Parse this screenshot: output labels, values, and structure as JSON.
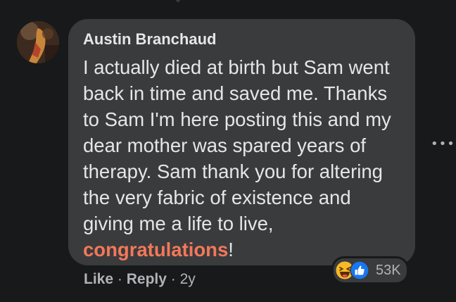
{
  "comment": {
    "author": "Austin Branchaud",
    "lines": [
      "I actually died at birth but Sam went",
      "back in time and saved me. Thanks",
      "to Sam I'm here posting this and my",
      "dear mother was spared years of",
      "therapy. Sam thank you for altering",
      "the very fabric of existence and",
      "giving me a life to live,"
    ],
    "highlight_word": "congratulations",
    "ending_punctuation": "!",
    "highlight_color": "#f3785a"
  },
  "actions": {
    "like_label": "Like",
    "reply_label": "Reply",
    "separator": "·",
    "timestamp": "2y"
  },
  "reactions": {
    "icons": [
      "haha-icon",
      "like-icon"
    ],
    "count": "53K"
  },
  "icons": {
    "more": "more-options-icon"
  },
  "colors": {
    "background": "#18191a",
    "bubble": "#3a3b3c",
    "text": "#e4e6eb",
    "secondary_text": "#b0b3b8",
    "like_blue": "#1877f2",
    "haha_yellow": "#f7b928"
  }
}
